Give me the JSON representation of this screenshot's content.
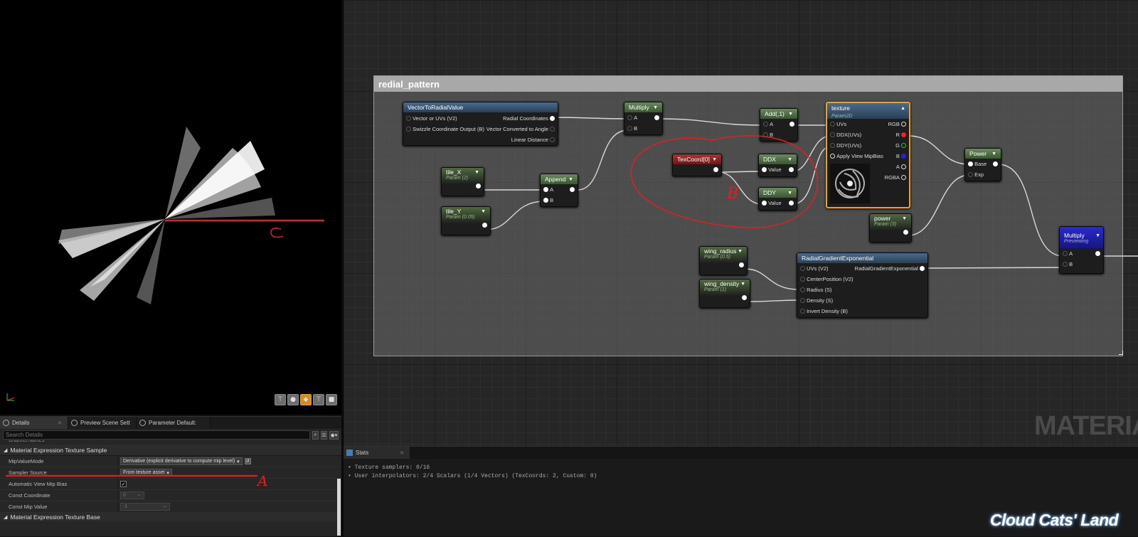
{
  "viewport": {
    "toolbar_buttons": [
      {
        "icon": "camera-icon",
        "active": false
      },
      {
        "icon": "sphere-icon",
        "active": false
      },
      {
        "icon": "plane-icon",
        "active": true
      },
      {
        "icon": "cube-icon",
        "active": false
      },
      {
        "icon": "mesh-icon",
        "active": false
      }
    ],
    "annotation_c": "C"
  },
  "details": {
    "tabs": [
      {
        "label": "Details",
        "icon": "details-icon"
      },
      {
        "label": "Preview Scene Sett",
        "icon": "search-icon"
      },
      {
        "label": "Parameter Default:",
        "icon": "search-icon"
      }
    ],
    "search_placeholder": "Search Details",
    "cut_row": "Channel Names",
    "section_title": "Material Expression Texture Sample",
    "section_bottom": "Material Expression Texture Base",
    "props": {
      "mip_label": "MipValueMode",
      "mip_value": "Derivative (explicit derivative to compute mip level)",
      "sampler_label": "Sampler Source",
      "sampler_value": "From texture asset",
      "auto_mip_label": "Automatic View Mip Bias",
      "auto_mip_checked": "✓",
      "const_coord_label": "Const Coordinate",
      "const_coord_value": "0",
      "const_mip_label": "Const Mip Value",
      "const_mip_value": "-1"
    },
    "annotation_a": "A"
  },
  "graph": {
    "comment_title": "redial_pattern",
    "watermark": "MATERIA",
    "annotation_b": "B",
    "nodes": {
      "v2r": {
        "title": "VectorToRadialValue",
        "in1": "Vector or UVs (V2)",
        "in2": "Swizzle Coordinate Output (B)",
        "out1": "Radial Coordinates",
        "out2": "Vector Converted to Angle",
        "out3": "Linear Distance"
      },
      "mul1": {
        "title": "Multiply",
        "a": "A",
        "b": "B"
      },
      "add": {
        "title": "Add(,1)",
        "a": "A",
        "b": "B"
      },
      "texture": {
        "title": "texture",
        "sub": "Param2D",
        "in1": "UVs",
        "in2": "DDX(UVs)",
        "in3": "DDY(UVs)",
        "in4": "Apply View MipBias",
        "o1": "RGB",
        "o2": "R",
        "o3": "G",
        "o4": "B",
        "o5": "A",
        "o6": "RGBA"
      },
      "texcoord": {
        "title": "TexCoord[0]"
      },
      "ddx": {
        "title": "DDX",
        "in": "Value"
      },
      "ddy": {
        "title": "DDY",
        "in": "Value"
      },
      "tilex": {
        "title": "tile_X",
        "sub": "Param (2)"
      },
      "tiley": {
        "title": "tile_Y",
        "sub": "Param (0.05)"
      },
      "append": {
        "title": "Append",
        "a": "A",
        "b": "B"
      },
      "power": {
        "title": "Power",
        "base": "Base",
        "exp": "Exp"
      },
      "powerp": {
        "title": "power",
        "sub": "Param (3)"
      },
      "mul2": {
        "title": "Multiply",
        "sub": "Previewing",
        "a": "A",
        "b": "B"
      },
      "wradius": {
        "title": "wing_radius",
        "sub": "Param (0.5)"
      },
      "wdensity": {
        "title": "wing_density",
        "sub": "Param (1)"
      },
      "rge": {
        "title": "RadialGradientExponential",
        "in1": "UVs (V2)",
        "in2": "CenterPosition (V2)",
        "in3": "Radius (S)",
        "in4": "Density (S)",
        "in5": "Invert Density (B)",
        "out": "RadialGradientExponential"
      }
    }
  },
  "stats": {
    "tab_label": "Stats",
    "lines": [
      "Texture samplers: 0/16",
      "User interpolators: 2/4 Scalars (1/4 Vectors) (TexCoords: 2, Custom: 0)"
    ]
  },
  "brand": "Cloud Cats' Land",
  "colors": {
    "annotation": "#e02020",
    "selected_border": "#f0a020"
  }
}
